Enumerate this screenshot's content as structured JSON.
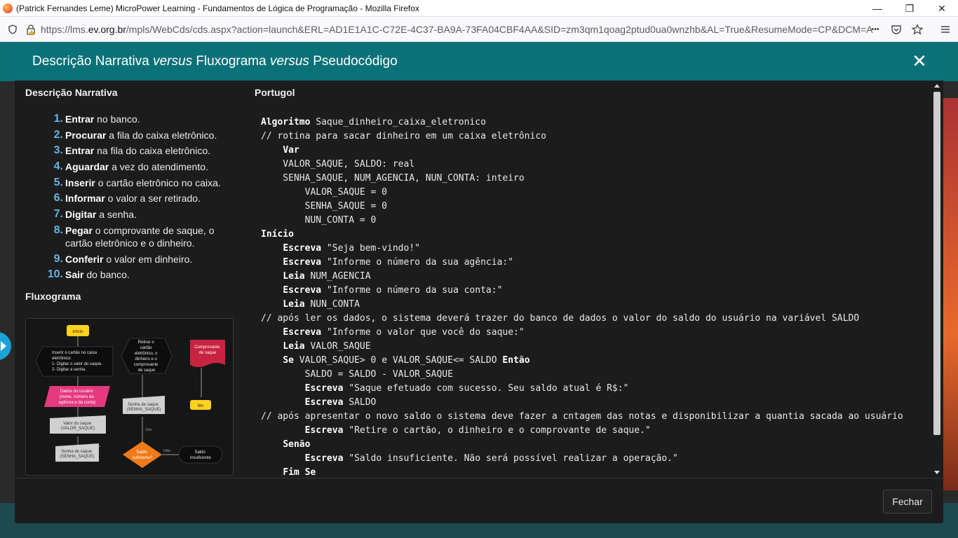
{
  "window": {
    "title": "(Patrick Fernandes Leme) MicroPower Learning - Fundamentos de Lógica de Programação - Mozilla Firefox",
    "minimize": "—",
    "restore": "❐",
    "close": "✕"
  },
  "navbar": {
    "url_prefix": "https://lms.",
    "url_host": "ev.org.br",
    "url_rest": "/mpls/WebCds/cds.aspx?action=launch&ERL=AD1E1A1C-C72E-4C37-BA9A-73FA04CBF4AA&SID=zm3qm1qoag2ptud0ua0wnzhb&AL=True&ResumeMode=CP&DCM=A",
    "more": "•••"
  },
  "modal": {
    "title_part1": "Descrição Narrativa ",
    "title_em1": "versus",
    "title_part2": " Fluxograma ",
    "title_em2": "versus",
    "title_part3": " Pseudocódigo",
    "close": "✕",
    "footer_button": "Fechar"
  },
  "narrative": {
    "title": "Descrição Narrativa",
    "steps": [
      {
        "num": "1.",
        "verb": "Entrar",
        "rest": " no banco."
      },
      {
        "num": "2.",
        "verb": "Procurar",
        "rest": " a fila do caixa eletrônico."
      },
      {
        "num": "3.",
        "verb": "Entrar",
        "rest": " na fila do caixa eletrônico."
      },
      {
        "num": "4.",
        "verb": "Aguardar",
        "rest": " a vez do atendimento."
      },
      {
        "num": "5.",
        "verb": "Inserir",
        "rest": " o cartão eletrônico no caixa."
      },
      {
        "num": "6.",
        "verb": "Informar",
        "rest": " o valor a ser retirado."
      },
      {
        "num": "7.",
        "verb": "Digitar",
        "rest": " a senha."
      },
      {
        "num": "8.",
        "verb": "Pegar",
        "rest": " o comprovante de saque, o cartão eletrônico e o dinheiro."
      },
      {
        "num": "9.",
        "verb": "Conferir",
        "rest": " o valor em dinheiro."
      },
      {
        "num": "10.",
        "verb": "Sair",
        "rest": " do banco."
      }
    ]
  },
  "flowchart": {
    "title": "Fluxograma",
    "inicio": "início",
    "inserir": [
      "Inserir o cartão no caixa",
      "eletrônico:",
      "1- Digitar o valor do saque.",
      "2- Digitar a senha."
    ],
    "retirar": [
      "Retirar o",
      "cartão",
      "eletrônico, o",
      "dinheiro e o",
      "comprovante",
      "de saque"
    ],
    "comprovante": [
      "Comprovante",
      "de saque"
    ],
    "dados": [
      "Dados do usuário",
      "(nome, número da",
      "agência e da conta)"
    ],
    "senha_saque_top": [
      "Senha de saque",
      "(SENHA_SAQUE)"
    ],
    "fim": "fim",
    "valor": [
      "Valor do saque",
      "(VALOR_SAQUE)"
    ],
    "sim": "Sim",
    "senha_saque": [
      "Senha de saque",
      "(SENHA_SAQUE)"
    ],
    "saldo_suf": [
      "Saldo",
      "suficiente?"
    ],
    "nao": "Não",
    "saldo_insuf": [
      "Saldo",
      "insuficiente"
    ]
  },
  "portugol": {
    "title": "Portugol",
    "lines": [
      [
        {
          "t": "Algoritmo",
          "k": true
        },
        {
          "t": " Saque_dinheiro_caixa_eletronico"
        }
      ],
      [
        {
          "t": "// rotina para sacar dinheiro em um caixa eletrônico"
        }
      ],
      [
        {
          "t": "    "
        },
        {
          "t": "Var",
          "k": true
        }
      ],
      [
        {
          "t": "    VALOR_SAQUE, SALDO: real"
        }
      ],
      [
        {
          "t": "    SENHA_SAQUE, NUM_AGENCIA, NUN_CONTA: inteiro"
        }
      ],
      [
        {
          "t": "        VALOR_SAQUE = 0"
        }
      ],
      [
        {
          "t": "        SENHA_SAQUE = 0"
        }
      ],
      [
        {
          "t": "        NUN_CONTA = 0"
        }
      ],
      [
        {
          "t": "Início",
          "k": true
        }
      ],
      [
        {
          "t": "    "
        },
        {
          "t": "Escreva",
          "k": true
        },
        {
          "t": " \"Seja bem-vindo!\""
        }
      ],
      [
        {
          "t": "    "
        },
        {
          "t": "Escreva",
          "k": true
        },
        {
          "t": " \"Informe o número da sua agência:\""
        }
      ],
      [
        {
          "t": "    "
        },
        {
          "t": "Leia",
          "k": true
        },
        {
          "t": " NUM_AGENCIA"
        }
      ],
      [
        {
          "t": "    "
        },
        {
          "t": "Escreva",
          "k": true
        },
        {
          "t": " \"Informe o número da sua conta:\""
        }
      ],
      [
        {
          "t": "    "
        },
        {
          "t": "Leia",
          "k": true
        },
        {
          "t": " NUN_CONTA"
        }
      ],
      [
        {
          "t": "// após ler os dados, o sistema deverá trazer do banco de dados o valor do saldo do usuário na variável SALDO"
        }
      ],
      [
        {
          "t": "    "
        },
        {
          "t": "Escreva",
          "k": true
        },
        {
          "t": " \"Informe o valor que você do saque:\""
        }
      ],
      [
        {
          "t": "    "
        },
        {
          "t": "Leia",
          "k": true
        },
        {
          "t": " VALOR_SAQUE"
        }
      ],
      [
        {
          "t": "    "
        },
        {
          "t": "Se",
          "k": true
        },
        {
          "t": " VALOR_SAQUE> 0 e VALOR_SAQUE<= SALDO "
        },
        {
          "t": "Então",
          "k": true
        }
      ],
      [
        {
          "t": "        SALDO = SALDO - VALOR_SAQUE"
        }
      ],
      [
        {
          "t": "        "
        },
        {
          "t": "Escreva",
          "k": true
        },
        {
          "t": " \"Saque efetuado com sucesso. Seu saldo atual é R$:\""
        }
      ],
      [
        {
          "t": "        "
        },
        {
          "t": "Escreva",
          "k": true
        },
        {
          "t": " SALDO"
        }
      ],
      [
        {
          "t": "// após apresentar o novo saldo o sistema deve fazer a cntagem das notas e disponibilizar a quantia sacada ao usuário"
        }
      ],
      [
        {
          "t": "        "
        },
        {
          "t": "Escreva",
          "k": true
        },
        {
          "t": " \"Retire o cartão, o dinheiro e o comprovante de saque.\""
        }
      ],
      [
        {
          "t": "    "
        },
        {
          "t": "Senão",
          "k": true
        }
      ],
      [
        {
          "t": "        "
        },
        {
          "t": "Escreva",
          "k": true
        },
        {
          "t": " \"Saldo insuficiente. Não será possível realizar a operação.\""
        }
      ],
      [
        {
          "t": "    "
        },
        {
          "t": "Fim Se",
          "k": true
        }
      ]
    ]
  },
  "colors": {
    "header": "#0b7178",
    "step_number": "#61b4e3",
    "flow_yellow": "#ffd21f",
    "flow_pink": "#e4397f",
    "flow_red": "#c8233f",
    "flow_orange": "#ef7a1a"
  }
}
